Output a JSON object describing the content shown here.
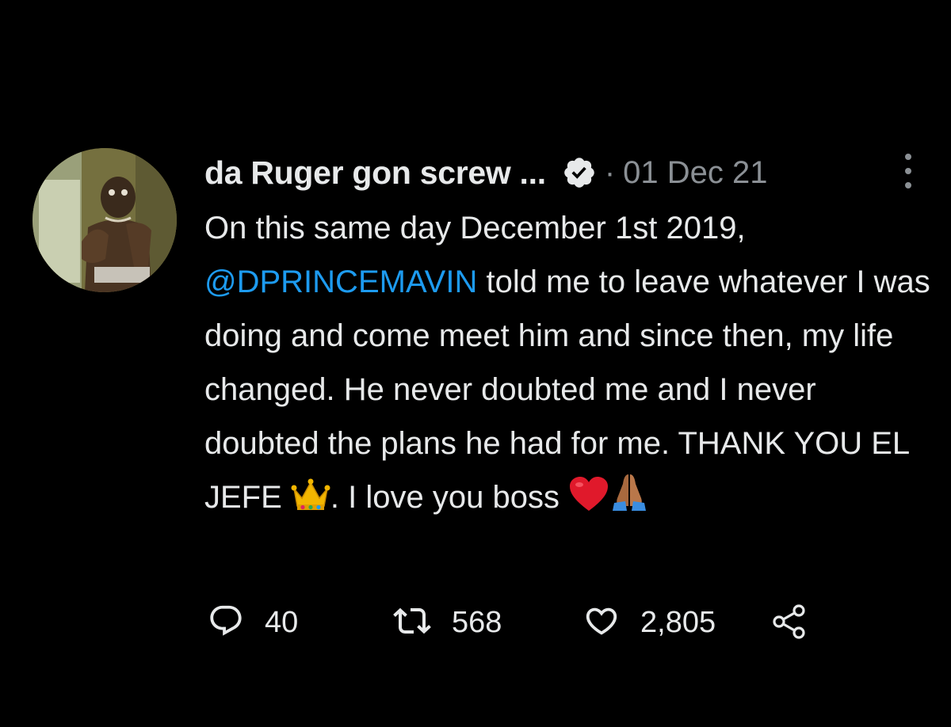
{
  "tweet": {
    "author": {
      "display_name": "da Ruger gon screw ...",
      "verified": true
    },
    "separator": "·",
    "date": "01 Dec 21",
    "text": {
      "part1": "On this same day December 1st 2019, ",
      "mention": "@DPRINCEMAVIN",
      "part2": " told me to leave whatever I was doing and come meet him and since then, my life changed. He never doubted me and I never doubted the plans he had for me. THANK YOU EL JEFE ",
      "emoji_crown": "👑",
      "part3": ". I love you boss ",
      "emoji_heart": "❤️",
      "emoji_pray": "🙏🏾"
    },
    "stats": {
      "replies": "40",
      "retweets": "568",
      "likes": "2,805"
    }
  },
  "icons": {
    "verified": "verified-badge-icon",
    "more": "more-options-icon",
    "reply": "reply-icon",
    "retweet": "retweet-icon",
    "like": "heart-icon",
    "share": "share-icon"
  },
  "colors": {
    "background": "#000000",
    "text": "#e7e9ea",
    "secondary": "#8b9095",
    "link": "#1d9bf0"
  }
}
